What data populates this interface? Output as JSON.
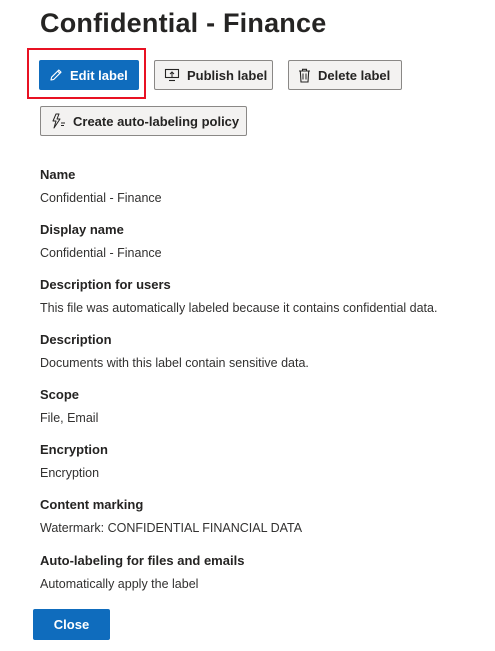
{
  "page": {
    "title": "Confidential - Finance"
  },
  "toolbar": {
    "edit_label": "Edit label",
    "publish_label": "Publish label",
    "delete_label": "Delete label",
    "auto_label": "Create auto-labeling policy"
  },
  "icons": {
    "edit": "pencil-icon",
    "publish": "publish-icon",
    "delete": "trash-icon",
    "auto": "auto-labeling-icon"
  },
  "fields": [
    {
      "label": "Name",
      "value": "Confidential - Finance"
    },
    {
      "label": "Display name",
      "value": "Confidential - Finance"
    },
    {
      "label": "Description for users",
      "value": "This file was automatically labeled because it contains confidential data."
    },
    {
      "label": "Description",
      "value": "Documents with this label contain sensitive data."
    },
    {
      "label": "Scope",
      "value": "File, Email"
    },
    {
      "label": "Encryption",
      "value": "Encryption"
    },
    {
      "label": "Content marking",
      "value": "Watermark: CONFIDENTIAL FINANCIAL DATA"
    },
    {
      "label": "Auto-labeling for files and emails",
      "value": "Automatically apply the label"
    }
  ],
  "footer": {
    "close_label": "Close"
  },
  "colors": {
    "primary": "#0f6cbd",
    "highlight": "#e81123",
    "text": "#323130"
  }
}
